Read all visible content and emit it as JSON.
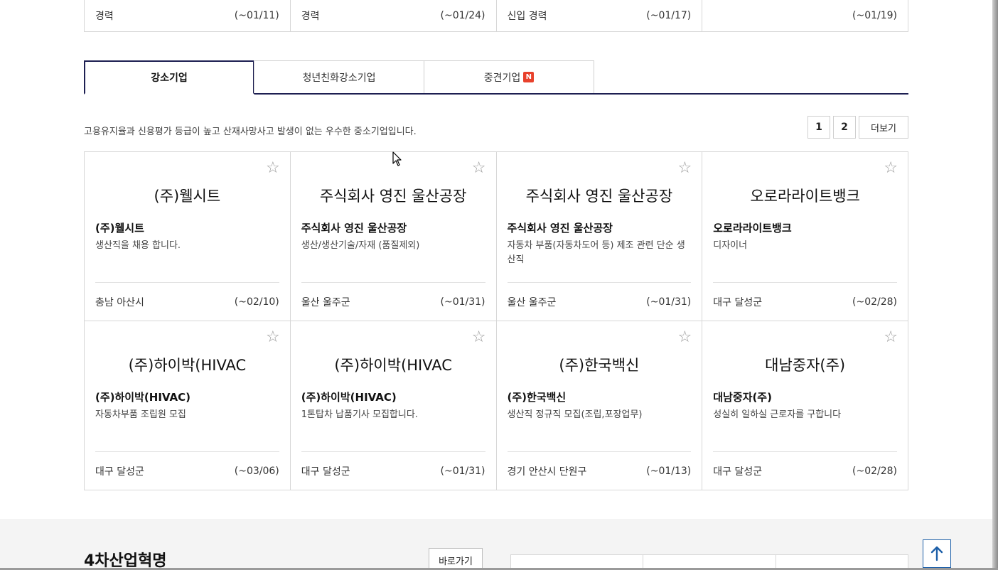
{
  "top_row": [
    {
      "career": "경력",
      "deadline": "(~01/11)"
    },
    {
      "career": "경력",
      "deadline": "(~01/24)"
    },
    {
      "career": "신입 경력",
      "deadline": "(~01/17)"
    },
    {
      "career": "",
      "deadline": "(~01/19)"
    }
  ],
  "tabs": [
    {
      "label": "강소기업"
    },
    {
      "label": "청년친화강소기업"
    },
    {
      "label": "중견기업",
      "badge": "N"
    }
  ],
  "description": "고용유지율과 신용평가 등급이 높고 산재사망사고 발생이 없는 우수한 중소기업입니다.",
  "pager": {
    "page1": "1",
    "page2": "2",
    "more": "더보기"
  },
  "cards": [
    {
      "logo": "(주)웰시트",
      "company": "(주)웰시트",
      "job": "생산직을 채용 합니다.",
      "location": "충남 아산시",
      "deadline": "(~02/10)"
    },
    {
      "logo": "주식회사 영진 울산공장",
      "company": "주식회사 영진 울산공장",
      "job": "생산/생산기술/자재 (품질제외)",
      "location": "울산 울주군",
      "deadline": "(~01/31)"
    },
    {
      "logo": "주식회사 영진 울산공장",
      "company": "주식회사 영진 울산공장",
      "job": "자동차 부품(자동차도어 등) 제조 관련 단순 생산직",
      "location": "울산 울주군",
      "deadline": "(~01/31)"
    },
    {
      "logo": "오로라라이트뱅크",
      "company": "오로라라이트뱅크",
      "job": "디자이너",
      "location": "대구 달성군",
      "deadline": "(~02/28)"
    },
    {
      "logo": "(주)하이박(HIVAC",
      "company": "(주)하이박(HIVAC)",
      "job": "자동차부품 조립원 모집",
      "location": "대구 달성군",
      "deadline": "(~03/06)"
    },
    {
      "logo": "(주)하이박(HIVAC",
      "company": "(주)하이박(HIVAC)",
      "job": "1톤탑차 납품기사 모집합니다.",
      "location": "대구 달성군",
      "deadline": "(~01/31)"
    },
    {
      "logo": "(주)한국백신",
      "company": "(주)한국백신",
      "job": "생산직 정규직 모집(조립,포장업무)",
      "location": "경기 안산시 단원구",
      "deadline": "(~01/13)"
    },
    {
      "logo": "대남중자(주)",
      "company": "대남중자(주)",
      "job": "성실히 일하실 근로자를 구합니다",
      "location": "대구 달성군",
      "deadline": "(~02/28)"
    }
  ],
  "bottom": {
    "title": "4차산업혁명",
    "go_button": "바로가기"
  },
  "icons": {
    "star": "star-outline-icon",
    "scroll_top": "arrow-up-icon"
  },
  "colors": {
    "tab_active_border": "#1d1f52",
    "badge": "#e8412c",
    "top_button": "#1d5fa8"
  }
}
